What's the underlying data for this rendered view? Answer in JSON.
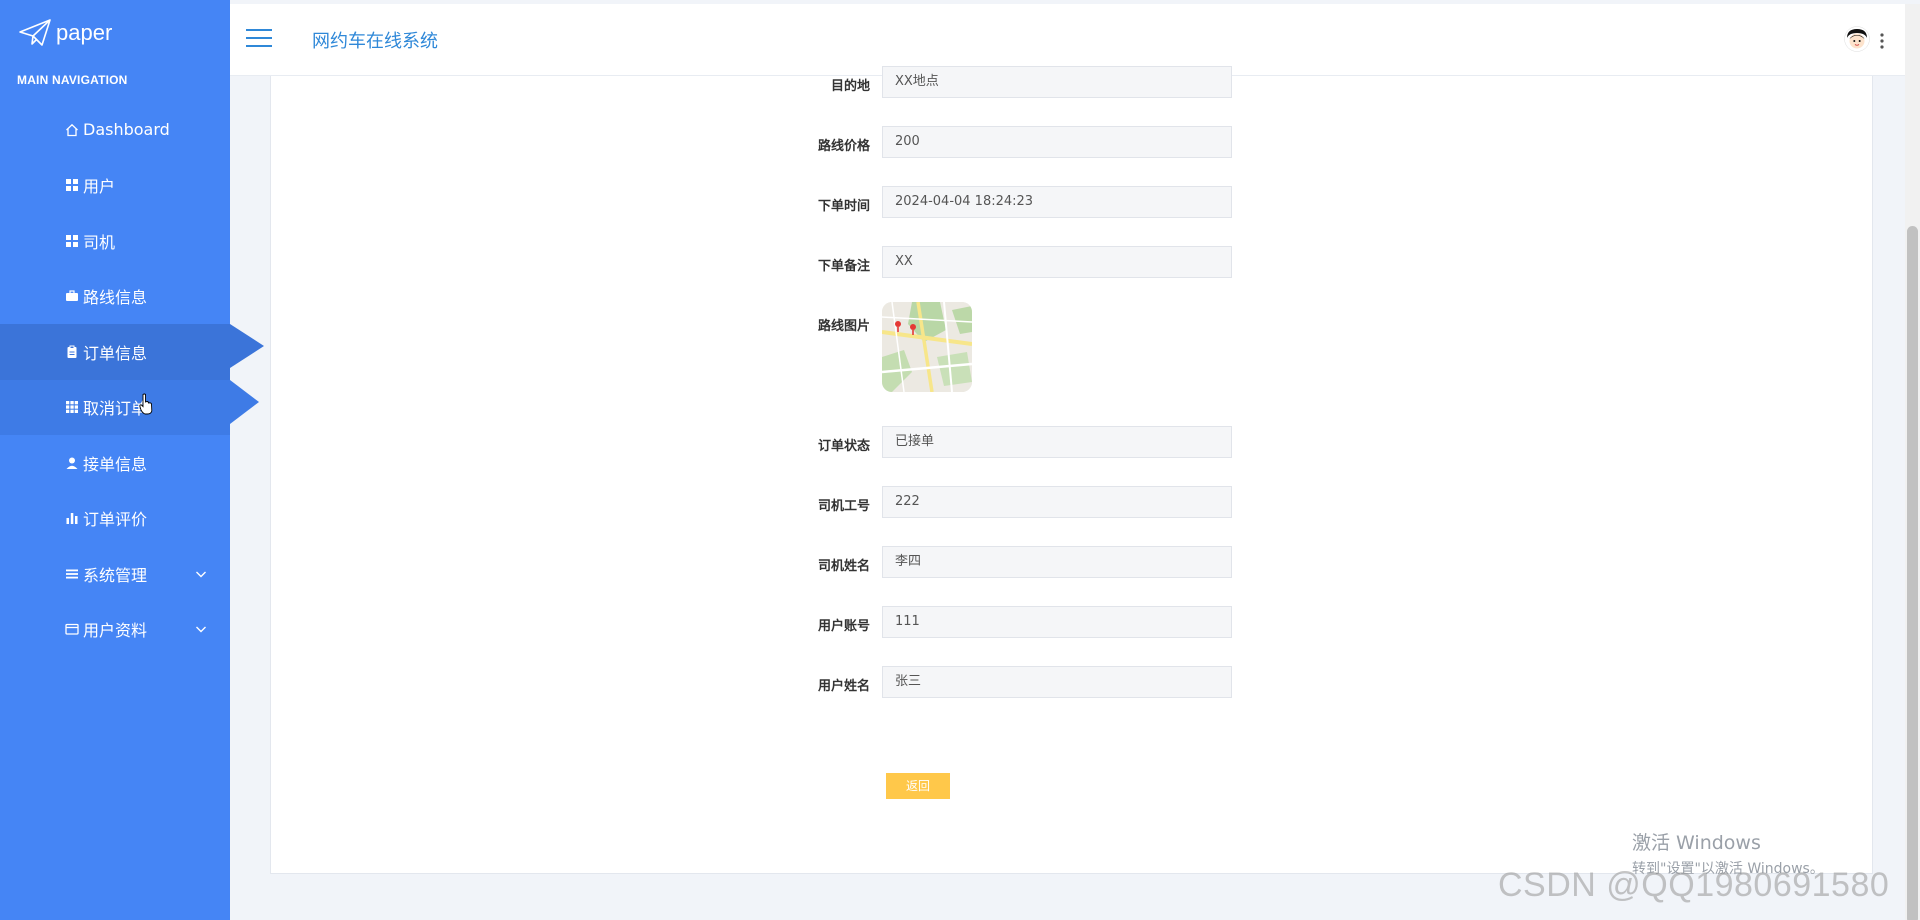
{
  "brand": {
    "name": "paper"
  },
  "sidebar": {
    "nav_title": "MAIN NAVIGATION",
    "items": [
      {
        "label": "Dashboard",
        "icon": "home-icon"
      },
      {
        "label": "用户",
        "icon": "grid-icon"
      },
      {
        "label": "司机",
        "icon": "grid-icon"
      },
      {
        "label": "路线信息",
        "icon": "briefcase-icon"
      },
      {
        "label": "订单信息",
        "icon": "clipboard-icon",
        "active": true
      },
      {
        "label": "取消订单",
        "icon": "apps-icon",
        "hovered": true
      },
      {
        "label": "接单信息",
        "icon": "user-icon"
      },
      {
        "label": "订单评价",
        "icon": "bar-chart-icon"
      },
      {
        "label": "系统管理",
        "icon": "list-icon",
        "expandable": true
      },
      {
        "label": "用户资料",
        "icon": "card-icon",
        "expandable": true
      }
    ]
  },
  "header": {
    "title": "网约车在线系统"
  },
  "form": {
    "fields": [
      {
        "label": "目的地",
        "value": "XX地点"
      },
      {
        "label": "路线价格",
        "value": "200"
      },
      {
        "label": "下单时间",
        "value": "2024-04-04 18:24:23"
      },
      {
        "label": "下单备注",
        "value": "XX"
      },
      {
        "label": "路线图片",
        "value": ""
      },
      {
        "label": "订单状态",
        "value": "已接单"
      },
      {
        "label": "司机工号",
        "value": "222"
      },
      {
        "label": "司机姓名",
        "value": "李四"
      },
      {
        "label": "用户账号",
        "value": "111"
      },
      {
        "label": "用户姓名",
        "value": "张三"
      }
    ],
    "back_label": "返回"
  },
  "watermark": {
    "win_line1": "激活 Windows",
    "win_line2": "转到\"设置\"以激活 Windows。",
    "csdn": "CSDN @QQ1980691580"
  },
  "colors": {
    "sidebar": "#4585f5",
    "accent": "#2f88d8",
    "button": "#ffc84a"
  }
}
